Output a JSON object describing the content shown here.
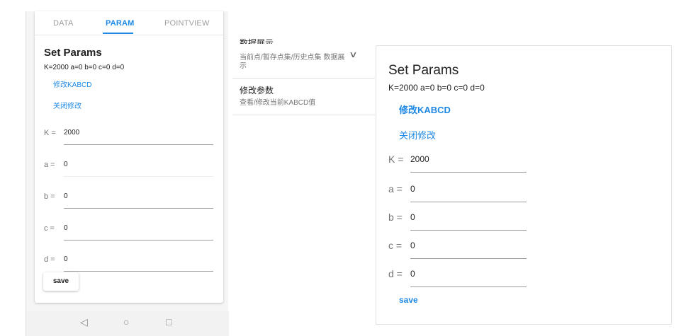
{
  "phone": {
    "tabs": [
      {
        "label": "DATA",
        "active": false
      },
      {
        "label": "PARAM",
        "active": true
      },
      {
        "label": "POINTVIEW",
        "active": false
      }
    ],
    "title": "Set Params",
    "summary": "K=2000 a=0 b=0 c=0 d=0",
    "edit_link": "修改KABCD",
    "close_link": "关闭修改",
    "fields": [
      {
        "label": "K",
        "value": "2000"
      },
      {
        "label": "a",
        "value": "0"
      },
      {
        "label": "b",
        "value": "0"
      },
      {
        "label": "c",
        "value": "0"
      },
      {
        "label": "d",
        "value": "0"
      }
    ],
    "save_label": "save",
    "nav": {
      "back": "◁",
      "home": "○",
      "recent": "□"
    }
  },
  "menu": {
    "items": [
      {
        "title": "数据展示",
        "desc": "当前点/暂存点集/历史点集 数据展示"
      },
      {
        "title": "修改参数",
        "desc": "查看/修改当前KABCD值"
      }
    ]
  },
  "card": {
    "title": "Set Params",
    "summary": "K=2000 a=0 b=0 c=0 d=0",
    "edit_link": "修改KABCD",
    "close_link": "关闭修改",
    "fields": [
      {
        "label": "K",
        "value": "2000"
      },
      {
        "label": "a",
        "value": "0"
      },
      {
        "label": "b",
        "value": "0"
      },
      {
        "label": "c",
        "value": "0"
      },
      {
        "label": "d",
        "value": "0"
      }
    ],
    "save_label": "save"
  },
  "colors": {
    "accent": "#1e88e5",
    "text": "#212121",
    "muted": "#757575"
  }
}
